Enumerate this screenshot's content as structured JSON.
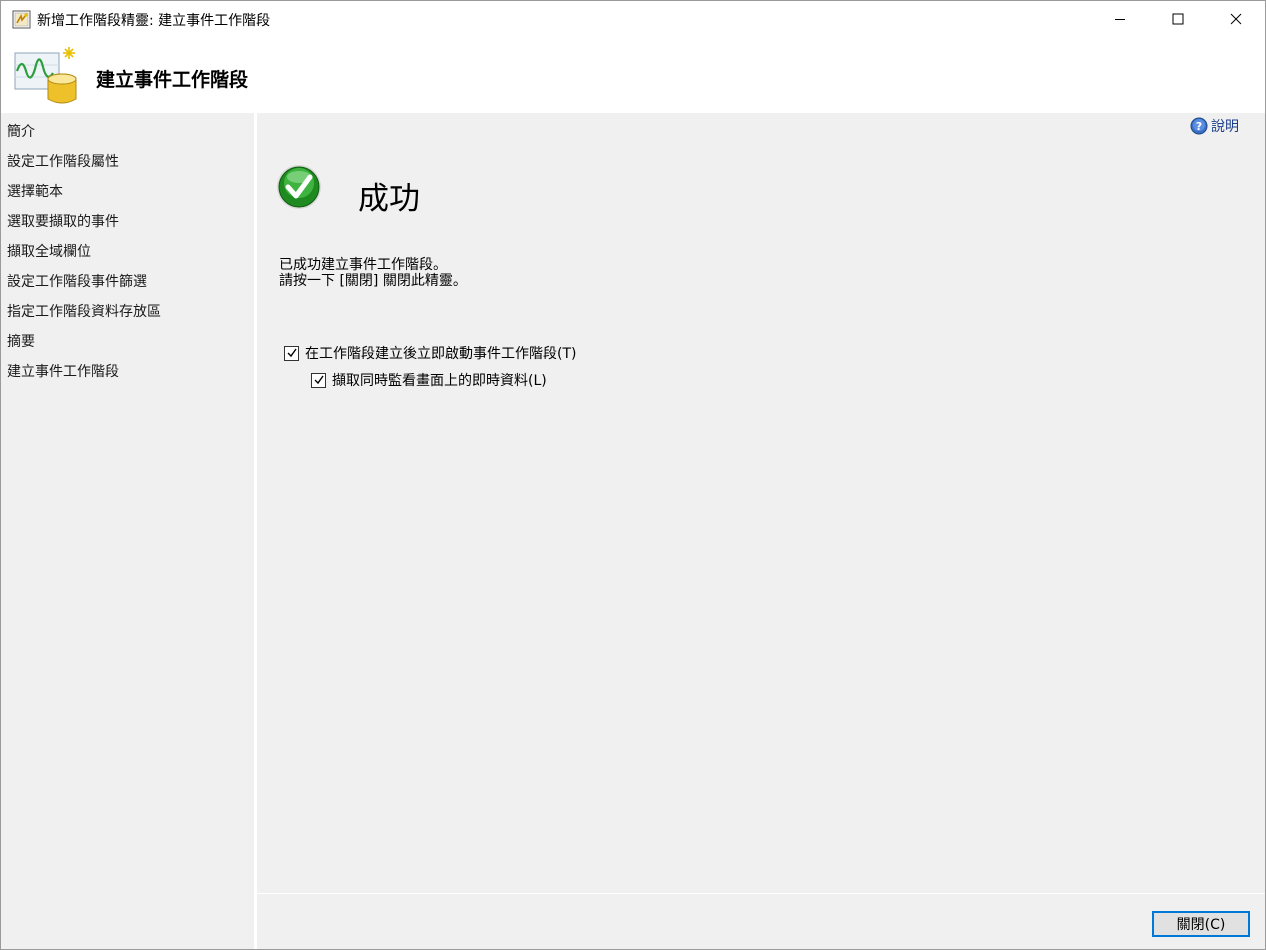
{
  "window": {
    "title": "新增工作階段精靈: 建立事件工作階段"
  },
  "header": {
    "title": "建立事件工作階段"
  },
  "sidebar": {
    "items": [
      {
        "label": "簡介"
      },
      {
        "label": "設定工作階段屬性"
      },
      {
        "label": "選擇範本"
      },
      {
        "label": "選取要擷取的事件"
      },
      {
        "label": "擷取全域欄位"
      },
      {
        "label": "設定工作階段事件篩選"
      },
      {
        "label": "指定工作階段資料存放區"
      },
      {
        "label": "摘要"
      },
      {
        "label": "建立事件工作階段"
      }
    ]
  },
  "main": {
    "help_label": "說明",
    "status_title": "成功",
    "message_line1": "已成功建立事件工作階段。",
    "message_line2": "請按一下 [關閉] 關閉此精靈。",
    "options": [
      {
        "label": "在工作階段建立後立即啟動事件工作階段(T)",
        "checked": true
      },
      {
        "label": "擷取同時監看畫面上的即時資料(L)",
        "checked": true
      }
    ]
  },
  "footer": {
    "close_label": "關閉(C)"
  },
  "colors": {
    "accent": "#0078d7",
    "panel_bg": "#f0f0f0",
    "success_green": "#2e9d2e",
    "help_blue": "#1a3e8a"
  },
  "icons": {
    "title": "wizard-icon",
    "header": "event-session-chart-database-icon",
    "success": "checkmark-success-icon",
    "help": "help-question-icon"
  }
}
